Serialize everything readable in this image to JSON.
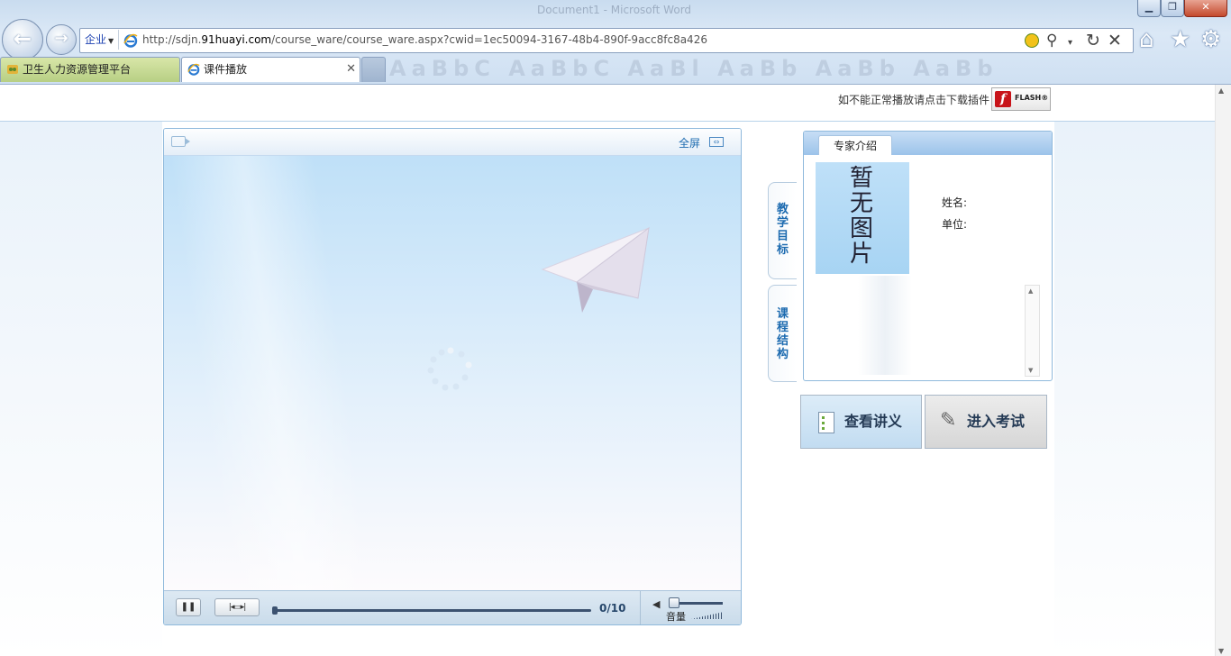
{
  "window": {
    "ghost_title": "Document1 - Microsoft Word",
    "min_glyph": "▁",
    "restore_glyph": "❐",
    "close_glyph": "✕"
  },
  "browser": {
    "back_glyph": "←",
    "forward_glyph": "→",
    "enterprise_label": "企业",
    "url_prefix": "http://sdjn.",
    "url_domain": "91huayi.com",
    "url_path": "/course_ware/course_ware.aspx?cwid=1ec50094-3167-48b4-890f-9acc8fc8a426",
    "icons": {
      "search": "⚲",
      "dropdown": "▾",
      "refresh": "↻",
      "stop": "✕",
      "home": "⌂",
      "favorites": "★",
      "tools": "⚙"
    },
    "tabs": [
      {
        "label": "卫生人力资源管理平台",
        "active": false
      },
      {
        "label": "课件播放",
        "active": true
      }
    ],
    "tab_close_glyph": "✕",
    "ghost_ribbon": "AaBbC AaBbC AaBl AaBb AaBb AaBb"
  },
  "page": {
    "flash_note": "如不能正常播放请点击下载插件",
    "flash_logo_letter": "f",
    "flash_badge": "FLASH®",
    "player": {
      "fullscreen_label": "全屏",
      "fullscreen_glyph": "⇔",
      "pause_glyph": "❚❚",
      "step_glyph": "|◂▭▸|",
      "time": "0/10",
      "progress": 0,
      "volume_glyph": "◀",
      "volume_label": "音量",
      "volume_level": 0
    },
    "side_tabs": {
      "goal": "教学目标",
      "structure": "课程结构"
    },
    "expert": {
      "tab_label": "专家介绍",
      "photo_placeholder": "暂无图片",
      "name_label": "姓名:",
      "unit_label": "单位:",
      "scroll_up": "▲",
      "scroll_down": "▼"
    },
    "actions": {
      "handout": "查看讲义",
      "exam": "进入考试",
      "pencil_glyph": "✎"
    },
    "scroll_up": "▲",
    "scroll_down": "▼"
  }
}
